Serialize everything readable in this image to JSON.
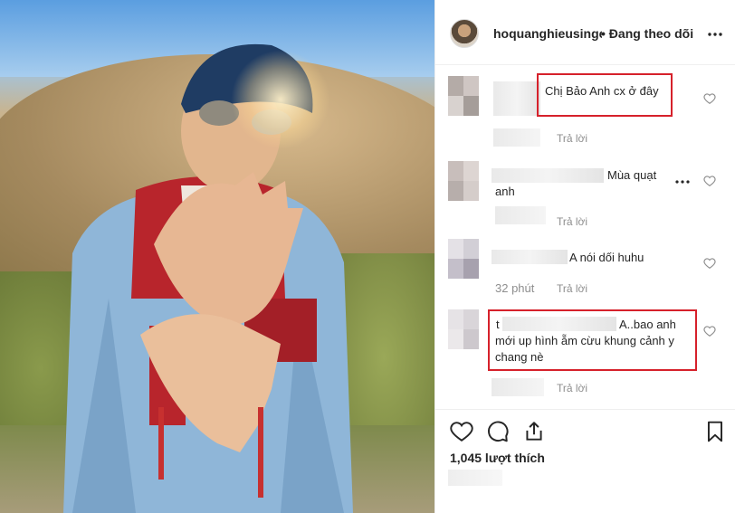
{
  "post": {
    "username": "hoquanghieusinger",
    "follow_status": "• Đang theo dõi",
    "more_icon": "more-horizontal-icon"
  },
  "comments": [
    {
      "text": "Chị Bảo Anh cx ở đây",
      "reply_label": "Trả lời",
      "highlighted": true
    },
    {
      "text": "Mùa quạt",
      "text_cont": "anh",
      "reply_label": "Trả lời",
      "highlighted": false
    },
    {
      "text": "A nói dối huhu",
      "time": "32 phút",
      "reply_label": "Trả lời",
      "highlighted": false
    },
    {
      "prefix": "t",
      "text": "A..bao anh",
      "text_cont": "mới up hình ẵm cừu khung cảnh y",
      "text_cont2": "chang nè",
      "reply_label": "Trả lời",
      "highlighted": true
    }
  ],
  "actions": {
    "likes": "1,045 lượt thích",
    "icons": [
      "heart-icon",
      "comment-icon",
      "share-icon",
      "bookmark-icon"
    ]
  },
  "colors": {
    "highlight_border": "#d6212b",
    "muted_text": "#8e8e8e",
    "primary_text": "#262626"
  }
}
